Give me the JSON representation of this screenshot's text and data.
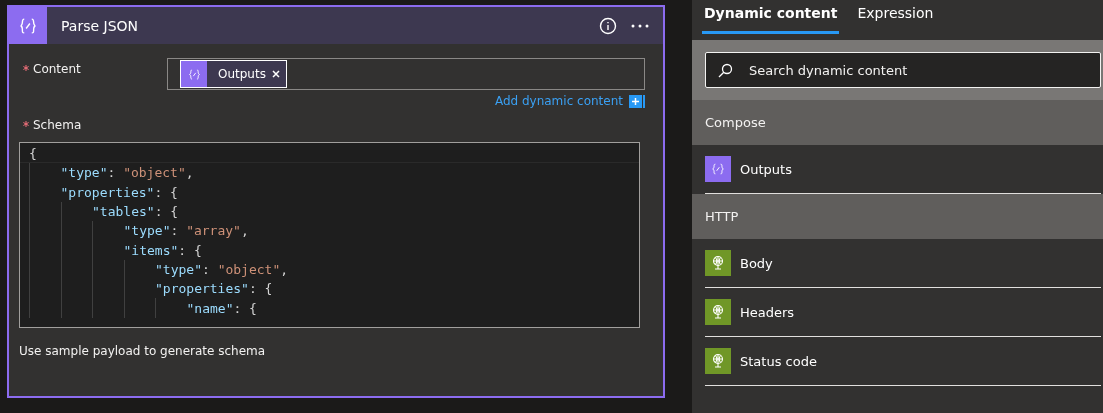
{
  "card": {
    "title": "Parse JSON",
    "fields": [
      {
        "label": "Content",
        "required": true,
        "tokens": [
          {
            "label": "Outputs",
            "kind": "compose"
          }
        ],
        "link": "Add dynamic content"
      },
      {
        "label": "Schema",
        "required": true
      }
    ],
    "schema": [
      {
        "tokens": [
          {
            "kind": "punct",
            "text": "{"
          }
        ],
        "children": [
          {
            "tokens": [
              {
                "kind": "key",
                "text": "\"type\""
              },
              {
                "kind": "punct",
                "text": ": "
              },
              {
                "kind": "string",
                "text": "\"object\""
              },
              {
                "kind": "punct",
                "text": ","
              }
            ]
          },
          {
            "tokens": [
              {
                "kind": "key",
                "text": "\"properties\""
              },
              {
                "kind": "punct",
                "text": ": {"
              }
            ],
            "children": [
              {
                "tokens": [
                  {
                    "kind": "key",
                    "text": "\"tables\""
                  },
                  {
                    "kind": "punct",
                    "text": ": {"
                  }
                ],
                "children": [
                  {
                    "tokens": [
                      {
                        "kind": "key",
                        "text": "\"type\""
                      },
                      {
                        "kind": "punct",
                        "text": ": "
                      },
                      {
                        "kind": "string",
                        "text": "\"array\""
                      },
                      {
                        "kind": "punct",
                        "text": ","
                      }
                    ]
                  },
                  {
                    "tokens": [
                      {
                        "kind": "key",
                        "text": "\"items\""
                      },
                      {
                        "kind": "punct",
                        "text": ": {"
                      }
                    ],
                    "children": [
                      {
                        "tokens": [
                          {
                            "kind": "key",
                            "text": "\"type\""
                          },
                          {
                            "kind": "punct",
                            "text": ": "
                          },
                          {
                            "kind": "string",
                            "text": "\"object\""
                          },
                          {
                            "kind": "punct",
                            "text": ","
                          }
                        ]
                      },
                      {
                        "tokens": [
                          {
                            "kind": "key",
                            "text": "\"properties\""
                          },
                          {
                            "kind": "punct",
                            "text": ": {"
                          }
                        ],
                        "children": [
                          {
                            "tokens": [
                              {
                                "kind": "key",
                                "text": "\"name\""
                              },
                              {
                                "kind": "punct",
                                "text": ": {"
                              }
                            ]
                          }
                        ]
                      }
                    ]
                  }
                ]
              }
            ]
          }
        ]
      }
    ],
    "sample_link": "Use sample payload to generate schema"
  },
  "panel": {
    "tabs": [
      {
        "label": "Dynamic content",
        "selected": true
      },
      {
        "label": "Expression",
        "selected": false
      }
    ],
    "search": {
      "placeholder": "Search dynamic content"
    },
    "groups": [
      {
        "title": "Compose",
        "items": [
          {
            "label": "Outputs",
            "kind": "compose"
          }
        ]
      },
      {
        "title": "HTTP",
        "items": [
          {
            "label": "Body",
            "kind": "http"
          },
          {
            "label": "Headers",
            "kind": "http"
          },
          {
            "label": "Status code",
            "kind": "http"
          }
        ]
      }
    ]
  }
}
